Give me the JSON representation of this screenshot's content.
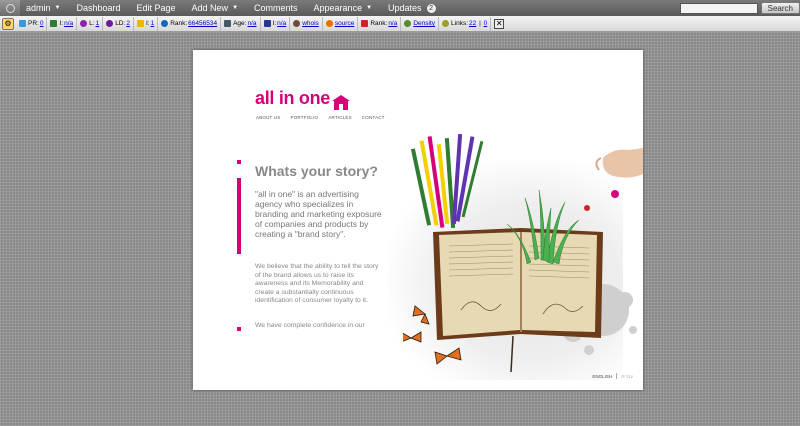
{
  "adminbar": {
    "menu": [
      {
        "label": "admin",
        "dropdown": true
      },
      {
        "label": "Dashboard",
        "dropdown": false
      },
      {
        "label": "Edit Page",
        "dropdown": false
      },
      {
        "label": "Add New",
        "dropdown": true
      },
      {
        "label": "Comments",
        "dropdown": false
      },
      {
        "label": "Appearance",
        "dropdown": true
      },
      {
        "label": "Updates",
        "dropdown": false
      }
    ],
    "updates_count": "2",
    "search_button": "Search",
    "search_value": ""
  },
  "seobar": {
    "items": [
      {
        "prefix": "PR:",
        "value": "0",
        "color": "#3a9ad9"
      },
      {
        "prefix": "I:",
        "value": "n/a",
        "color": "#2e7d32"
      },
      {
        "prefix": "L:",
        "value": "1",
        "color": "#8e24aa"
      },
      {
        "prefix": "LD:",
        "value": "2",
        "color": "#6a1b9a"
      },
      {
        "prefix": "I:",
        "value": "1",
        "color": "#f4b400"
      },
      {
        "prefix": "Rank:",
        "value": "66456534",
        "color": "#1565c0"
      },
      {
        "prefix": "Age:",
        "value": "n/a",
        "color": "#455a64"
      },
      {
        "prefix": "I:",
        "value": "n/a",
        "color": "#283593"
      },
      {
        "prefix": "",
        "value": "whois",
        "color": "#6d4c41"
      },
      {
        "prefix": "",
        "value": "source",
        "color": "#ef6c00"
      },
      {
        "prefix": "Rank:",
        "value": "n/a",
        "color": "#c62828"
      },
      {
        "prefix": "",
        "value": "Density",
        "color": "#558b2f"
      },
      {
        "prefix": "Links:",
        "value": "22",
        "extra": "0",
        "color": "#9e9d24"
      }
    ],
    "close_glyph": "✕"
  },
  "site": {
    "logo_text": "all in one",
    "nav": [
      "ABOUT US",
      "PORTFOLIO",
      "ARTICLES",
      "CONTACT"
    ],
    "headline": "Whats your story?",
    "intro": "\"all in one\" is an advertising agency who specializes in branding and marketing exposure of companies and products by creating a \"brand story\".",
    "body": "We believe that the ability to tell the story of the brand allows us to raise its awareness and its Memorability and create a substantially continuous identification of consumer loyalty to it.",
    "confidence": "We have complete confidence in our",
    "footer": {
      "lang_active": "ENGLISH",
      "lang_other": "עברית"
    },
    "colors": {
      "brand": "#d6007d",
      "text_grey": "#888888"
    }
  }
}
